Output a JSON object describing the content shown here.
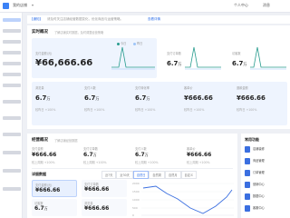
{
  "topbar": {
    "shop_selector": "我的店铺",
    "user": "个人中心",
    "extra": "消息"
  },
  "notice": {
    "tag": "【通知】",
    "text": "请及时关注店铺经营数据变化，优化商品与运营策略。",
    "link": "查看详情"
  },
  "realtime": {
    "title": "实时概况",
    "subtitle": "了解店铺实时数据，及时调整经营策略",
    "legend_today": "今日",
    "legend_yesterday": "昨日",
    "main_label": "支付金额(元)",
    "main_value": "¥66,666.66",
    "main_compare": "较昨日 +100%",
    "side_label": "支付订单数",
    "side_value": "6.7",
    "side_unit": "万",
    "side2_label": "访客数",
    "side2_value": "6.7",
    "side2_unit": "万"
  },
  "row_metrics": [
    {
      "label": "浏览量",
      "value": "6.7",
      "unit": "万",
      "compare": "较昨日 +100%"
    },
    {
      "label": "支付人数",
      "value": "6.7",
      "unit": "万",
      "compare": "较昨日 +100%"
    },
    {
      "label": "支付转化率",
      "value": "6.7",
      "unit": "万",
      "compare": "较昨日 +100%"
    },
    {
      "label": "客单价",
      "value": "¥666.66",
      "unit": "",
      "compare": "较昨日 +100%"
    },
    {
      "label": "退款金额",
      "value": "¥666.66",
      "unit": "",
      "compare": "较昨日 +100%"
    }
  ],
  "overview": {
    "title": "经营概况",
    "subtitle": "了解店铺经营数据",
    "cards": [
      {
        "label": "支付金额",
        "value": "¥666.66",
        "compare": "较上周期 +100%"
      },
      {
        "label": "支付订单数",
        "value": "6.7",
        "unit": "万",
        "compare": "较上周期 +100%"
      },
      {
        "label": "支付人数",
        "value": "6.7",
        "unit": "万",
        "compare": "较上周期 +100%"
      },
      {
        "label": "客单价",
        "value": "¥666.66",
        "compare": "较上周期 +100%"
      }
    ]
  },
  "detail": {
    "title": "详细数据",
    "tabs": [
      "近7天",
      "近30天",
      "自然日",
      "自然周",
      "自然月",
      "自定义"
    ],
    "cards": [
      {
        "label": "支付金额(元)",
        "value": "¥666.66",
        "compare": "较上周期 +100%"
      },
      {
        "label": "支付订单数",
        "value": "¥666.66",
        "compare": "较上周期 +100%"
      },
      {
        "label": "访客数",
        "value": "6.7",
        "unit": "万",
        "compare": "较上周期 +100%"
      },
      {
        "label": "浏览量",
        "value": "¥666.66",
        "compare": "较上周期 +100%"
      }
    ],
    "y_ticks": [
      "2000",
      "1500",
      "1000",
      "500",
      "0"
    ]
  },
  "side_panel": {
    "title": "常用功能",
    "items": [
      "店铺装修",
      "商品管理",
      "订单管理",
      "营销中心",
      "数据中心",
      "客服中心"
    ]
  },
  "colors": {
    "accent": "#2f6fe8",
    "line_today": "#2a9d8f",
    "line_yesterday": "#9ec5f8"
  }
}
